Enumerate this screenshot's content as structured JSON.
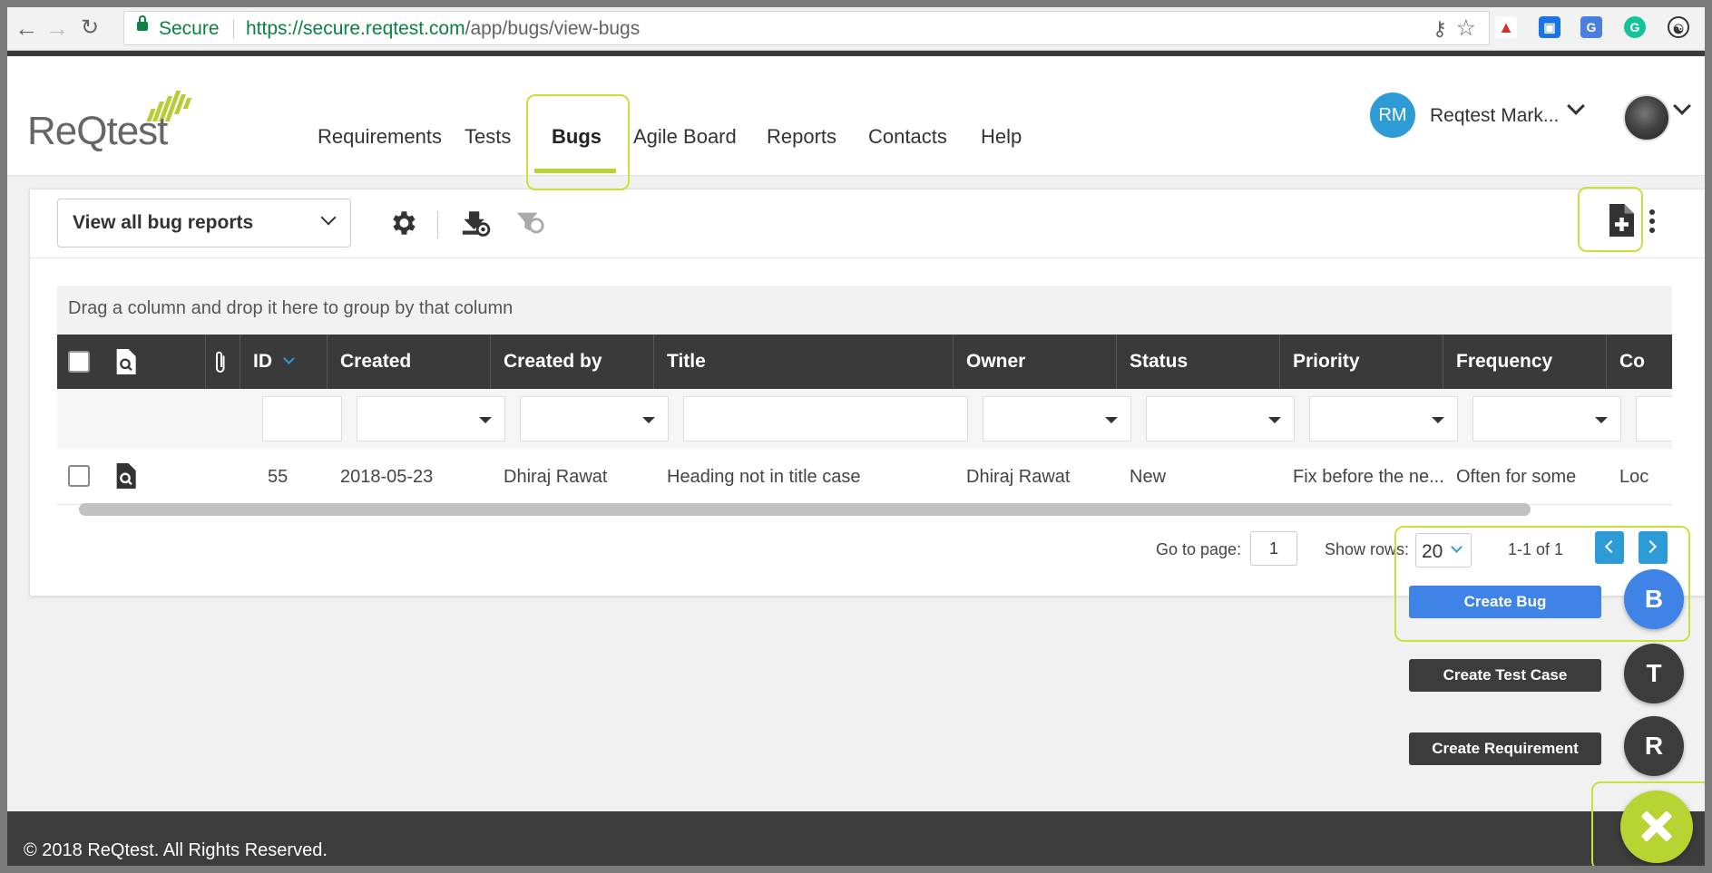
{
  "browser": {
    "secure_label": "Secure",
    "url_host": "https://secure.reqtest.com",
    "url_path": "/app/bugs/view-bugs"
  },
  "logo": {
    "text": "ReQtest"
  },
  "menu": {
    "items": [
      {
        "label": "Requirements"
      },
      {
        "label": "Tests"
      },
      {
        "label": "Bugs"
      },
      {
        "label": "Agile Board"
      },
      {
        "label": "Reports"
      },
      {
        "label": "Contacts"
      },
      {
        "label": "Help"
      }
    ],
    "active": "Bugs"
  },
  "user": {
    "initials": "RM",
    "name": "Reqtest Mark..."
  },
  "toolbar": {
    "view_select": "View all bug reports"
  },
  "group_bar": {
    "text": "Drag a column and drop it here to group by that column"
  },
  "grid": {
    "columns": [
      {
        "label": "ID"
      },
      {
        "label": "Created"
      },
      {
        "label": "Created by"
      },
      {
        "label": "Title"
      },
      {
        "label": "Owner"
      },
      {
        "label": "Status"
      },
      {
        "label": "Priority"
      },
      {
        "label": "Frequency"
      },
      {
        "label": "Co"
      }
    ],
    "rows": [
      {
        "id": "55",
        "created": "2018-05-23",
        "created_by": "Dhiraj Rawat",
        "title": "Heading not in title case",
        "owner": "Dhiraj Rawat",
        "status": "New",
        "priority": "Fix before the ne...",
        "frequency": "Often for some",
        "co": "Loc"
      }
    ]
  },
  "pager": {
    "goto_label": "Go to page:",
    "page": "1",
    "rows_label": "Show rows:",
    "rows_value": "20",
    "range": "1-1 of 1"
  },
  "fab": {
    "actions": [
      {
        "label": "Create Bug",
        "letter": "B",
        "color": "#3f83e6"
      },
      {
        "label": "Create Test Case",
        "letter": "T",
        "color": "#3c3c3c"
      },
      {
        "label": "Create Requirement",
        "letter": "R",
        "color": "#3c3c3c"
      }
    ]
  },
  "footer": {
    "text": "© 2018 ReQtest. All Rights Reserved."
  },
  "colors": {
    "accent": "#b8d432",
    "blue": "#2d9bd6",
    "header_dark": "#3a3a3a"
  },
  "icons": [
    "back-icon",
    "forward-icon",
    "reload-icon",
    "lock-icon",
    "key-icon",
    "star-icon",
    "gear-icon",
    "download-view-icon",
    "filter-reset-icon",
    "new-document-icon",
    "kebab-icon",
    "magnifier-icon",
    "paperclip-icon",
    "close-icon"
  ]
}
